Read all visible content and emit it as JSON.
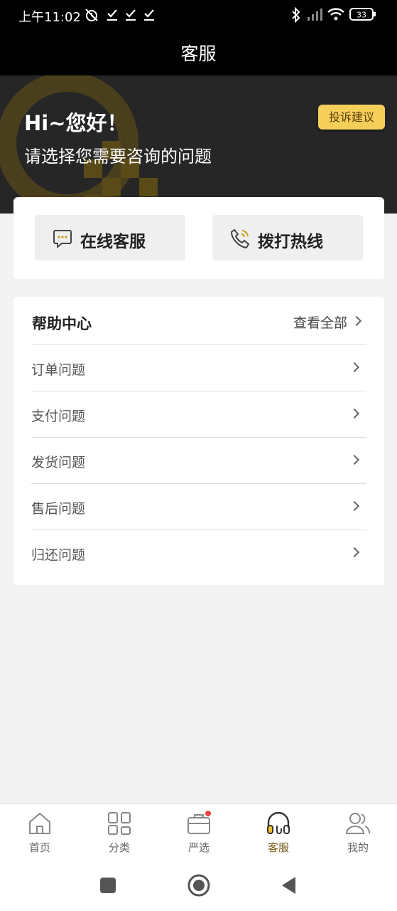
{
  "status_bar": {
    "time": "上午11:02",
    "battery": "33",
    "icons": [
      "alarm-off-icon",
      "check-icon",
      "check-icon",
      "check-icon",
      "bluetooth-icon",
      "signal-icon",
      "wifi-icon",
      "battery-icon"
    ]
  },
  "header": {
    "title": "客服"
  },
  "banner": {
    "greeting": "Hi~您好！",
    "subtitle": "请选择您需要咨询的问题",
    "complaint_button": "投诉建议",
    "accent_color": "#f6cf5b"
  },
  "contact": {
    "online_label": "在线客服",
    "online_icon": "chat-bubble-icon",
    "hotline_label": "拨打热线",
    "hotline_icon": "phone-call-icon"
  },
  "help_center": {
    "title": "帮助中心",
    "view_all": "查看全部",
    "items": [
      {
        "label": "订单问题"
      },
      {
        "label": "支付问题"
      },
      {
        "label": "发货问题"
      },
      {
        "label": "售后问题"
      },
      {
        "label": "归还问题"
      }
    ]
  },
  "tab_bar": {
    "active_color": "#7a5a17",
    "tabs": [
      {
        "label": "首页",
        "icon": "home-icon",
        "active": false
      },
      {
        "label": "分类",
        "icon": "grid-icon",
        "active": false
      },
      {
        "label": "严选",
        "icon": "bag-icon",
        "active": false,
        "badge_dot": true
      },
      {
        "label": "客服",
        "icon": "headset-icon",
        "active": true
      },
      {
        "label": "我的",
        "icon": "user-icon",
        "active": false
      }
    ]
  },
  "system_nav": {
    "icons": [
      "recents-icon",
      "home-circle-icon",
      "back-icon"
    ]
  }
}
